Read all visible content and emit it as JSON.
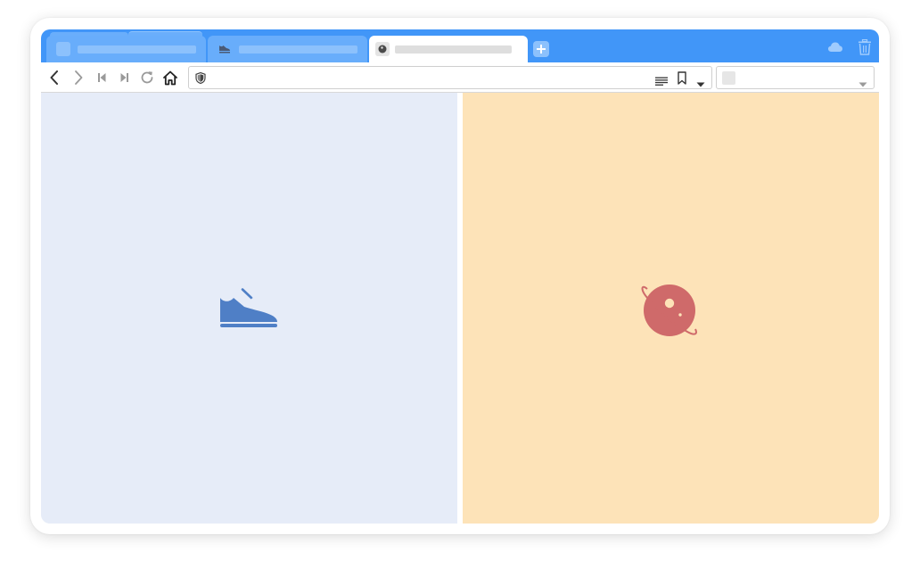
{
  "browser": {
    "tabs": [
      {
        "title": "",
        "favicon": "blank-favicon",
        "active": false
      },
      {
        "title": "",
        "favicon": "shoe-favicon",
        "active": false
      },
      {
        "title": "",
        "favicon": "planet-favicon",
        "active": true
      }
    ],
    "url": "",
    "search_text": "",
    "colors": {
      "tabbar": "#4196f8",
      "inactive_tab": "#68adfb",
      "left_pane": "#e6ecf8",
      "right_pane": "#fde3b8",
      "shoe_icon": "#4f7fc6",
      "planet_icon": "#cf6a6a"
    }
  },
  "content": {
    "left_pane_icon": "shoe-icon",
    "right_pane_icon": "planet-icon"
  }
}
